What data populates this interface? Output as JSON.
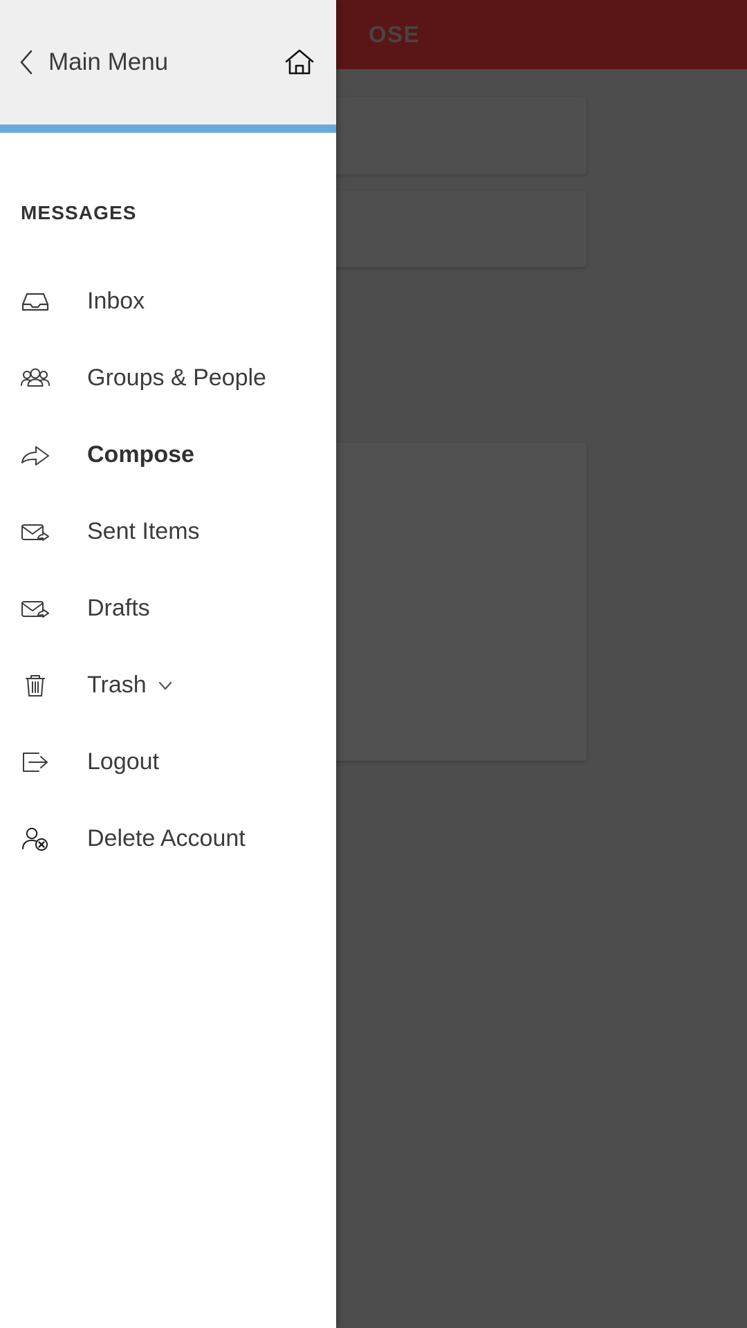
{
  "background": {
    "appbar_title": "OSE",
    "appbar_color": "#5a1616",
    "overlay_color": "#4d4d4d"
  },
  "drawer": {
    "back_icon": "chevron-left-icon",
    "title": "Main Menu",
    "home_icon": "home-icon",
    "accent_color": "#6aa9dd",
    "section_title": "MESSAGES",
    "items": [
      {
        "label": "Inbox",
        "icon": "inbox-icon",
        "active": false,
        "has_caret": false
      },
      {
        "label": "Groups & People",
        "icon": "people-group-icon",
        "active": false,
        "has_caret": false
      },
      {
        "label": "Compose",
        "icon": "compose-arrow-icon",
        "active": true,
        "has_caret": false
      },
      {
        "label": "Sent Items",
        "icon": "envelope-sent-icon",
        "active": false,
        "has_caret": false
      },
      {
        "label": "Drafts",
        "icon": "envelope-draft-icon",
        "active": false,
        "has_caret": false
      },
      {
        "label": "Trash",
        "icon": "trash-icon",
        "active": false,
        "has_caret": true
      },
      {
        "label": "Logout",
        "icon": "logout-icon",
        "active": false,
        "has_caret": false
      },
      {
        "label": "Delete Account",
        "icon": "user-delete-icon",
        "active": false,
        "has_caret": false
      }
    ]
  }
}
